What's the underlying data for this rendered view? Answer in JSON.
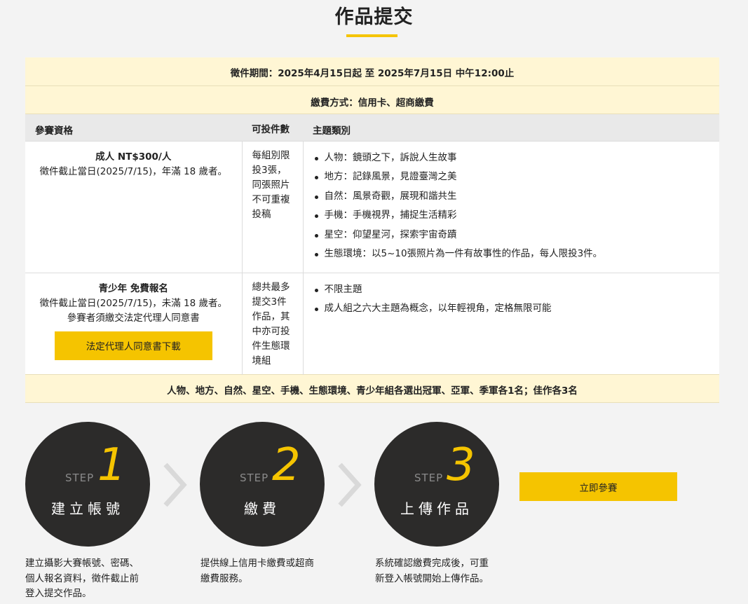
{
  "page": {
    "title": "作品提交"
  },
  "info": {
    "period": "徵件期間：2025年4月15日起 至 2025年7月15日 中午12:00止",
    "payment": "繳費方式：信用卡、超商繳費",
    "headers": {
      "eligibility": "參賽資格",
      "entries": "可投件數",
      "categories": "主題類別"
    },
    "adult": {
      "title": "成人 NT$300/人",
      "condition": "徵件截止當日(2025/7/15)，年滿 18 歲者。",
      "entries_lines": [
        "每組別限",
        "投3張，",
        "同張照片",
        "不可重複",
        "投稿"
      ],
      "topics": [
        "人物：鏡頭之下，訴說人生故事",
        "地方：記錄風景，見證臺灣之美",
        "自然：風景奇觀，展現和諧共生",
        "手機：手機視界，捕捉生活精彩",
        "星空：仰望星河，探索宇宙奇蹟",
        "生態環境：以5~10張照片為一件有故事性的作品，每人限投3件。"
      ]
    },
    "youth": {
      "title": "青少年 免費報名",
      "condition": "徵件截止當日(2025/7/15)，未滿 18 歲者。",
      "note": "參賽者須繳交法定代理人同意書",
      "download_label": "法定代理人同意書下載",
      "entries_lines": [
        "總共最多",
        "提交3件",
        "作品，其",
        "中亦可投",
        "件生態環",
        "境組"
      ],
      "topics": [
        "不限主題",
        "成人組之六大主題為概念，以年輕視角，定格無限可能"
      ]
    },
    "awards": "人物、地方、自然、星空、手機、生態環境、青少年組各選出冠軍、亞軍、季軍各1名；佳作各3名"
  },
  "steps": [
    {
      "word": "STEP",
      "number": "1",
      "label": "建立帳號",
      "desc_lines": [
        "建立攝影大賽帳號、密碼、",
        "個人報名資料，徵件截止前",
        "登入提交作品。"
      ]
    },
    {
      "word": "STEP",
      "number": "2",
      "label": "繳費",
      "desc_lines": [
        "提供線上信用卡繳費或超商",
        "繳費服務。"
      ]
    },
    {
      "word": "STEP",
      "number": "3",
      "label": "上傳作品",
      "desc_lines": [
        "系統確認繳費完成後，可重",
        "新登入帳號開始上傳作品。"
      ]
    }
  ],
  "join_button": "立即參賽",
  "colors": {
    "accent": "#f5c400",
    "highlight_bg": "#fff6d4",
    "circle": "#2c2b2a",
    "background": "#f3f3f3"
  },
  "icons": {
    "chevron": "chevron-right-icon"
  }
}
